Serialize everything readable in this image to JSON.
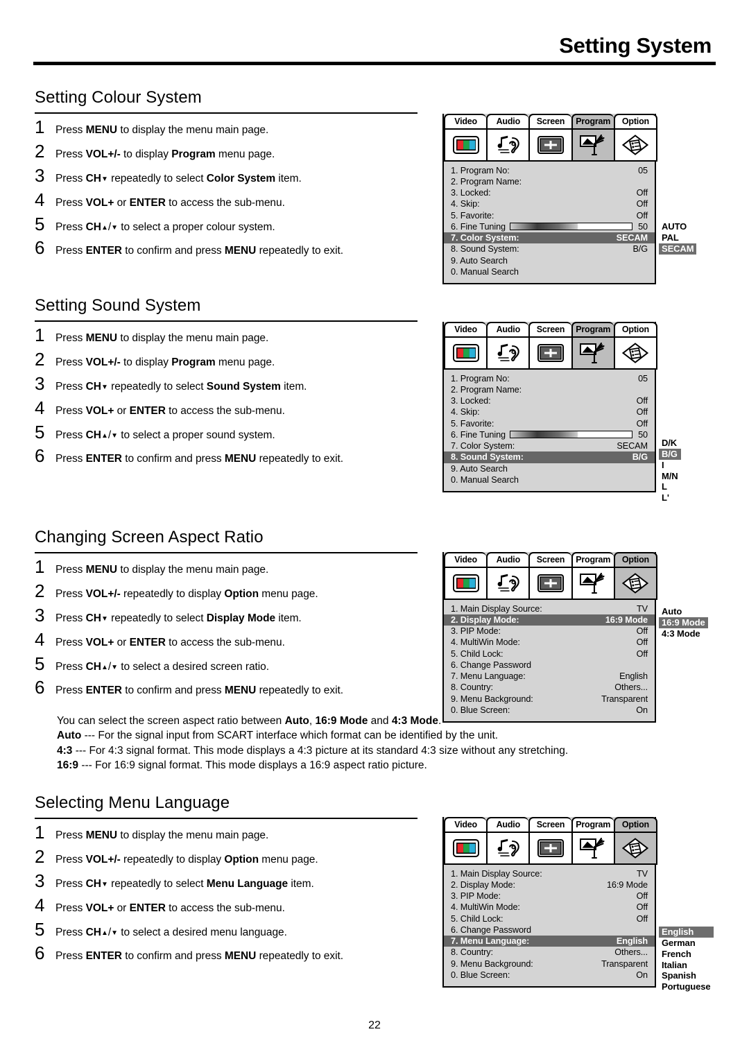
{
  "page": {
    "header_title": "Setting System",
    "page_number": "22"
  },
  "sections": [
    {
      "heading": "Setting Colour System",
      "steps": [
        {
          "num": "1",
          "html": "Press <b>MENU</b> to display the menu main page."
        },
        {
          "num": "2",
          "html": "Press <b>VOL+/-</b> to display <b>Program</b> menu page."
        },
        {
          "num": "3",
          "html": "Press <b>CH</b><span class=\"caret\">▼</span> repeatedly to select <b>Color System</b> item."
        },
        {
          "num": "4",
          "html": "Press <b>VOL+</b> or <b>ENTER</b> to access the sub-menu."
        },
        {
          "num": "5",
          "html": "Press <b>CH</b><span class=\"caret\">▲</span>/<span class=\"caret\">▼</span> to select a proper colour system."
        },
        {
          "num": "6",
          "html": "Press <b>ENTER</b> to confirm and press <b>MENU</b> repeatedly to exit."
        }
      ]
    },
    {
      "heading": "Setting Sound System",
      "steps": [
        {
          "num": "1",
          "html": "Press <b>MENU</b> to display the menu main page."
        },
        {
          "num": "2",
          "html": "Press <b>VOL+/-</b> to display <b>Program</b> menu page."
        },
        {
          "num": "3",
          "html": "Press <b>CH</b><span class=\"caret\">▼</span> repeatedly to select <b>Sound System</b> item."
        },
        {
          "num": "4",
          "html": "Press <b>VOL+</b> or <b>ENTER</b> to access the sub-menu."
        },
        {
          "num": "5",
          "html": "Press <b>CH</b><span class=\"caret\">▲</span>/<span class=\"caret\">▼</span> to select a proper sound system."
        },
        {
          "num": "6",
          "html": "Press <b>ENTER</b> to confirm and press <b>MENU</b> repeatedly to exit."
        }
      ]
    },
    {
      "heading": "Changing Screen Aspect Ratio",
      "steps": [
        {
          "num": "1",
          "html": "Press <b>MENU</b> to display the menu main page."
        },
        {
          "num": "2",
          "html": "Press <b>VOL+/-</b> repeatedly to display <b>Option</b> menu page."
        },
        {
          "num": "3",
          "html": "Press <b>CH</b><span class=\"caret\">▼</span> repeatedly to select <b>Display Mode</b> item."
        },
        {
          "num": "4",
          "html": "Press <b>VOL+</b> or <b>ENTER</b> to access the sub-menu."
        },
        {
          "num": "5",
          "html": "Press <b>CH</b><span class=\"caret\">▲</span>/<span class=\"caret\">▼</span> to select a desired screen ratio."
        },
        {
          "num": "6",
          "html": "Press <b>ENTER</b> to confirm and press <b>MENU</b> repeatedly to exit."
        }
      ]
    },
    {
      "heading": "Selecting Menu Language",
      "steps": [
        {
          "num": "1",
          "html": "Press <b>MENU</b> to display the menu main page."
        },
        {
          "num": "2",
          "html": "Press <b>VOL+/-</b> repeatedly to display <b>Option</b> menu page."
        },
        {
          "num": "3",
          "html": "Press <b>CH</b><span class=\"caret\">▼</span> repeatedly to select <b>Menu Language</b> item."
        },
        {
          "num": "4",
          "html": "Press <b>VOL+</b> or <b>ENTER</b> to access the sub-menu."
        },
        {
          "num": "5",
          "html": "Press <b>CH</b><span class=\"caret\">▲</span>/<span class=\"caret\">▼</span> to select a desired menu language."
        },
        {
          "num": "6",
          "html": "Press <b>ENTER</b> to confirm and press <b>MENU</b> repeatedly to exit."
        }
      ]
    }
  ],
  "aspect_notes": [
    "You can select the screen aspect ratio between <b>Auto</b>, <b>16:9 Mode</b> and <b>4:3 Mode</b>.",
    "<b>Auto</b> --- For the signal input from SCART interface which format can be identified by the unit.",
    "<b>4:3</b> --- For 4:3 signal format. This mode displays a 4:3 picture at its standard 4:3 size without any stretching.",
    "<b>16:9</b> --- For 16:9 signal format. This mode displays a 16:9 aspect ratio picture."
  ],
  "osd_tabs": [
    {
      "label": "Video",
      "icon": "video-bars-icon"
    },
    {
      "label": "Audio",
      "icon": "note-ear-icon"
    },
    {
      "label": "Screen",
      "icon": "screen-crosshair-icon"
    },
    {
      "label": "Program",
      "icon": "antenna-tv-icon"
    },
    {
      "label": "Option",
      "icon": "list-document-icon"
    }
  ],
  "colors": {
    "osd_background": "#d4d4d4",
    "tab_active": "#bdbdbd",
    "row_selected": "#666666",
    "submenu_highlight": "#6e6e6e",
    "video_icon_red": "#e8282b",
    "video_icon_green": "#1fa34a",
    "video_icon_blue": "#2ab0d8"
  },
  "menus": {
    "program_color_system": {
      "active_tab": "Program",
      "rows": [
        {
          "label": "1. Program No:",
          "value": "05",
          "selected": false,
          "bar": false
        },
        {
          "label": "2. Program Name:",
          "value": "",
          "selected": false,
          "bar": false
        },
        {
          "label": "3. Locked:",
          "value": "Off",
          "selected": false,
          "bar": false
        },
        {
          "label": "4. Skip:",
          "value": "Off",
          "selected": false,
          "bar": false
        },
        {
          "label": "5. Favorite:",
          "value": "Off",
          "selected": false,
          "bar": false
        },
        {
          "label": "6. Fine Tuning",
          "value": "50",
          "selected": false,
          "bar": true
        },
        {
          "label": "7. Color System:",
          "value": "SECAM",
          "selected": true,
          "bar": false
        },
        {
          "label": "8. Sound System:",
          "value": "B/G",
          "selected": false,
          "bar": false
        },
        {
          "label": "9. Auto Search",
          "value": "",
          "selected": false,
          "bar": false
        },
        {
          "label": "0. Manual Search",
          "value": "",
          "selected": false,
          "bar": false
        }
      ],
      "submenu": [
        {
          "label": "AUTO",
          "highlighted": false
        },
        {
          "label": "PAL",
          "highlighted": false
        },
        {
          "label": "SECAM",
          "highlighted": true
        }
      ]
    },
    "program_sound_system": {
      "active_tab": "Program",
      "rows": [
        {
          "label": "1. Program No:",
          "value": "05",
          "selected": false,
          "bar": false
        },
        {
          "label": "2. Program Name:",
          "value": "",
          "selected": false,
          "bar": false
        },
        {
          "label": "3. Locked:",
          "value": "Off",
          "selected": false,
          "bar": false
        },
        {
          "label": "4. Skip:",
          "value": "Off",
          "selected": false,
          "bar": false
        },
        {
          "label": "5. Favorite:",
          "value": "Off",
          "selected": false,
          "bar": false
        },
        {
          "label": "6. Fine Tuning",
          "value": "50",
          "selected": false,
          "bar": true
        },
        {
          "label": "7. Color System:",
          "value": "SECAM",
          "selected": false,
          "bar": false
        },
        {
          "label": "8. Sound System:",
          "value": "B/G",
          "selected": true,
          "bar": false
        },
        {
          "label": "9. Auto Search",
          "value": "",
          "selected": false,
          "bar": false
        },
        {
          "label": "0. Manual Search",
          "value": "",
          "selected": false,
          "bar": false
        }
      ],
      "submenu": [
        {
          "label": "D/K",
          "highlighted": false
        },
        {
          "label": "B/G",
          "highlighted": true
        },
        {
          "label": "I",
          "highlighted": false
        },
        {
          "label": "M/N",
          "highlighted": false
        },
        {
          "label": "L",
          "highlighted": false
        },
        {
          "label": "L'",
          "highlighted": false
        }
      ]
    },
    "option_display_mode": {
      "active_tab": "Option",
      "rows": [
        {
          "label": "1. Main Display Source:",
          "value": "TV",
          "selected": false,
          "bar": false
        },
        {
          "label": "2. Display Mode:",
          "value": "16:9 Mode",
          "selected": true,
          "bar": false
        },
        {
          "label": "3. PIP Mode:",
          "value": "Off",
          "selected": false,
          "bar": false
        },
        {
          "label": "4. MultiWin Mode:",
          "value": "Off",
          "selected": false,
          "bar": false
        },
        {
          "label": "5. Child Lock:",
          "value": "Off",
          "selected": false,
          "bar": false
        },
        {
          "label": "6. Change Password",
          "value": "",
          "selected": false,
          "bar": false
        },
        {
          "label": "7. Menu Language:",
          "value": "English",
          "selected": false,
          "bar": false
        },
        {
          "label": "8. Country:",
          "value": "Others...",
          "selected": false,
          "bar": false
        },
        {
          "label": "9. Menu Background:",
          "value": "Transparent",
          "selected": false,
          "bar": false
        },
        {
          "label": "0. Blue Screen:",
          "value": "On",
          "selected": false,
          "bar": false
        }
      ],
      "submenu": [
        {
          "label": "Auto",
          "highlighted": false
        },
        {
          "label": "16:9 Mode",
          "highlighted": true
        },
        {
          "label": "4:3 Mode",
          "highlighted": false
        }
      ]
    },
    "option_menu_language": {
      "active_tab": "Option",
      "rows": [
        {
          "label": "1. Main Display Source:",
          "value": "TV",
          "selected": false,
          "bar": false
        },
        {
          "label": "2. Display Mode:",
          "value": "16:9 Mode",
          "selected": false,
          "bar": false
        },
        {
          "label": "3. PIP Mode:",
          "value": "Off",
          "selected": false,
          "bar": false
        },
        {
          "label": "4. MultiWin Mode:",
          "value": "Off",
          "selected": false,
          "bar": false
        },
        {
          "label": "5. Child Lock:",
          "value": "Off",
          "selected": false,
          "bar": false
        },
        {
          "label": "6. Change Password",
          "value": "",
          "selected": false,
          "bar": false
        },
        {
          "label": "7. Menu Language:",
          "value": "English",
          "selected": true,
          "bar": false
        },
        {
          "label": "8. Country:",
          "value": "Others...",
          "selected": false,
          "bar": false
        },
        {
          "label": "9. Menu Background:",
          "value": "Transparent",
          "selected": false,
          "bar": false
        },
        {
          "label": "0. Blue Screen:",
          "value": "On",
          "selected": false,
          "bar": false
        }
      ],
      "submenu": [
        {
          "label": "English",
          "highlighted": true
        },
        {
          "label": "German",
          "highlighted": false
        },
        {
          "label": "French",
          "highlighted": false
        },
        {
          "label": "Italian",
          "highlighted": false
        },
        {
          "label": "Spanish",
          "highlighted": false
        },
        {
          "label": "Portuguese",
          "highlighted": false
        }
      ]
    }
  }
}
